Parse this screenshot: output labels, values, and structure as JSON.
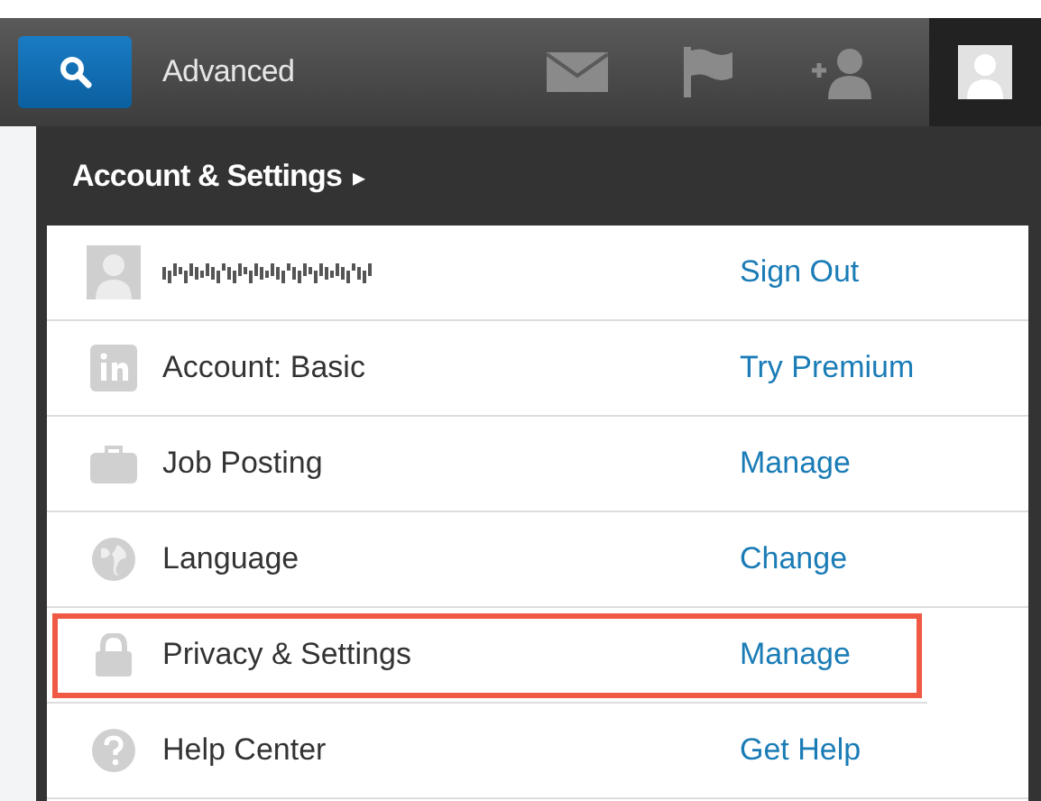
{
  "top_bar": {
    "advanced_link": "Advanced",
    "icons": [
      {
        "kind": "mail"
      },
      {
        "kind": "flag"
      },
      {
        "kind": "add-person"
      }
    ],
    "profile": {
      "selected": true
    }
  },
  "menu": {
    "title": "Account & Settings",
    "caret": "▸",
    "rows": [
      {
        "kind": "user",
        "action": "Sign Out",
        "highlighted": false
      },
      {
        "kind": "account",
        "label": "Account: Basic",
        "action": "Try Premium",
        "highlighted": false
      },
      {
        "kind": "jobs",
        "label": "Job Posting",
        "action": "Manage",
        "highlighted": false
      },
      {
        "kind": "language",
        "label": "Language",
        "action": "Change",
        "highlighted": false
      },
      {
        "kind": "privacy",
        "label": "Privacy & Settings",
        "action": "Manage",
        "highlighted": true
      },
      {
        "kind": "help",
        "label": "Help Center",
        "action": "Get Help",
        "highlighted": false
      }
    ]
  }
}
